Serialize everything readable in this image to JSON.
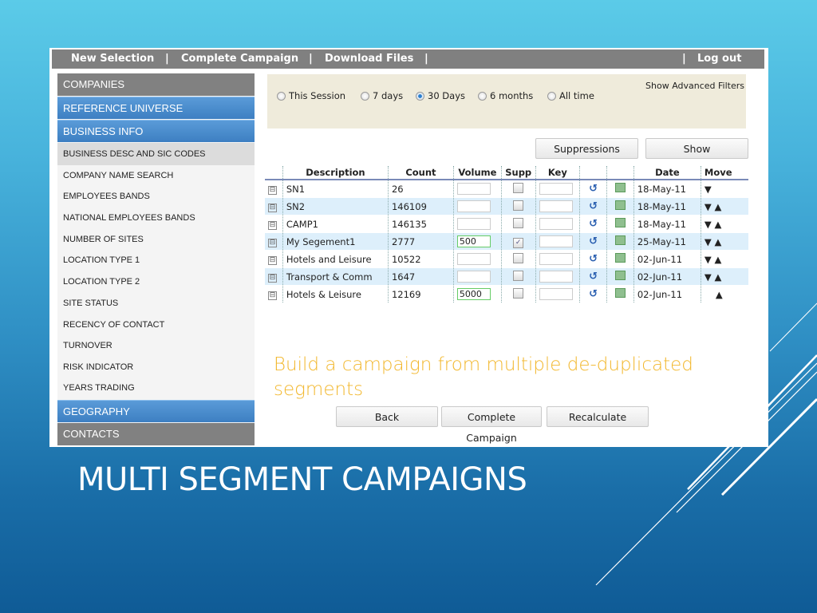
{
  "slide": {
    "title": "MULTI SEGMENT CAMPAIGNS",
    "tagline": "Build a campaign from multiple de-duplicated segments"
  },
  "topnav": {
    "new_selection": "New Selection",
    "complete_campaign": "Complete Campaign",
    "download_files": "Download Files",
    "log_out": "Log out",
    "separator": "|"
  },
  "sidebar": {
    "sections": [
      {
        "label": "COMPANIES",
        "style": "grey"
      },
      {
        "label": "REFERENCE UNIVERSE",
        "style": "blue"
      },
      {
        "label": "BUSINESS INFO",
        "style": "blue"
      }
    ],
    "items": [
      "BUSINESS DESC AND SIC CODES",
      "COMPANY NAME SEARCH",
      "EMPLOYEES BANDS",
      "NATIONAL EMPLOYEES BANDS",
      "NUMBER OF SITES",
      "LOCATION TYPE 1",
      "LOCATION TYPE 2",
      "SITE STATUS",
      "RECENCY OF CONTACT",
      "TURNOVER",
      "RISK INDICATOR",
      "YEARS TRADING"
    ],
    "selected_item": "BUSINESS DESC AND SIC CODES",
    "bottom_sections": [
      {
        "label": "GEOGRAPHY",
        "style": "blue"
      },
      {
        "label": "CONTACTS",
        "style": "grey"
      }
    ]
  },
  "filters": {
    "period_options": [
      "This Session",
      "7 days",
      "30 Days",
      "6 months",
      "All time"
    ],
    "selected_period": "30 Days",
    "advanced_link": "Show Advanced Filters"
  },
  "actions": {
    "suppressions": "Suppressions",
    "show": "Show",
    "back": "Back",
    "complete_campaign": "Complete Campaign",
    "recalculate": "Recalculate"
  },
  "table": {
    "columns": [
      "",
      "Description",
      "Count",
      "Volume",
      "Supp",
      "Key",
      "",
      "",
      "Date",
      "Move"
    ],
    "rows": [
      {
        "description": "SN1",
        "count": "26",
        "volume": "",
        "supp": false,
        "key": "",
        "date": "18-May-11",
        "move_down": true,
        "move_up": false
      },
      {
        "description": "SN2",
        "count": "146109",
        "volume": "",
        "supp": false,
        "key": "",
        "date": "18-May-11",
        "move_down": true,
        "move_up": true
      },
      {
        "description": "CAMP1",
        "count": "146135",
        "volume": "",
        "supp": false,
        "key": "",
        "date": "18-May-11",
        "move_down": true,
        "move_up": true
      },
      {
        "description": "My Segement1",
        "count": "2777",
        "volume": "500",
        "supp": true,
        "key": "",
        "date": "25-May-11",
        "move_down": true,
        "move_up": true
      },
      {
        "description": "Hotels and Leisure",
        "count": "10522",
        "volume": "",
        "supp": false,
        "key": "",
        "date": "02-Jun-11",
        "move_down": true,
        "move_up": true
      },
      {
        "description": "Transport & Comm",
        "count": "1647",
        "volume": "",
        "supp": false,
        "key": "",
        "date": "02-Jun-11",
        "move_down": true,
        "move_up": true
      },
      {
        "description": "Hotels & Leisure",
        "count": "12169",
        "volume": "5000",
        "supp": false,
        "key": "",
        "date": "02-Jun-11",
        "move_down": false,
        "move_up": true
      }
    ],
    "icons": {
      "collapse": "⊟",
      "undo": "↺",
      "excel": "excel-icon",
      "down": "▼",
      "up": "▲",
      "check": "✓"
    }
  },
  "colors": {
    "accent_blue": "#3d7fc2",
    "nav_grey": "#808080",
    "tagline": "#f2b72c",
    "filter_bg": "#efebdb",
    "row_alt": "#ddeffb"
  }
}
